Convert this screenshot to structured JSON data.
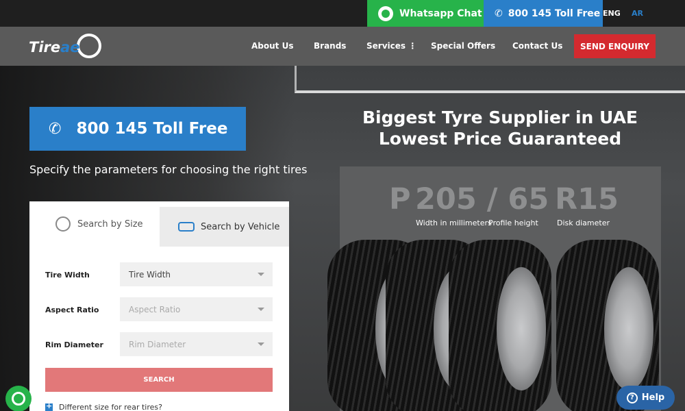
{
  "topbar": {
    "whatsapp_label": "Whatsapp Chat",
    "tollfree_label": "800 145 Toll Free",
    "lang_eng": "ENG",
    "lang_ar": "AR"
  },
  "logo": {
    "text_main": "Tire",
    "text_accent": "ae"
  },
  "nav": {
    "about": "About Us",
    "brands": "Brands",
    "services": "Services ⋮",
    "special": "Special Offers",
    "contact": "Contact Us",
    "enquiry": "SEND ENQUIRY"
  },
  "hero": {
    "tollfree_big": "800 145 Toll Free",
    "spec_text": "Specify the parameters for choosing the right tires",
    "headline_line1": "Biggest Tyre Supplier in UAE",
    "headline_line2": "Lowest Price Guaranteed"
  },
  "tire_size": {
    "p": "P",
    "width_profile": "205 / 65",
    "rim": "R15",
    "width_label": "Width in millimeters",
    "height_label": "Profile height",
    "disk_label": "Disk diameter"
  },
  "search": {
    "tab_size": "Search by Size",
    "tab_vehicle": "Search by Vehicle",
    "width_label": "Tire Width",
    "width_value": "Tire Width",
    "aspect_label": "Aspect Ratio",
    "aspect_value": "Aspect Ratio",
    "rim_label": "Rim Diameter",
    "rim_value": "Rim Diameter",
    "button": "SEARCH",
    "rear_label": "Different size for rear tires?"
  },
  "help_label": "Help",
  "colors": {
    "blue": "#2a7fc9",
    "green": "#27b34a",
    "red": "#d42a2f",
    "search_btn": "#e27879"
  }
}
